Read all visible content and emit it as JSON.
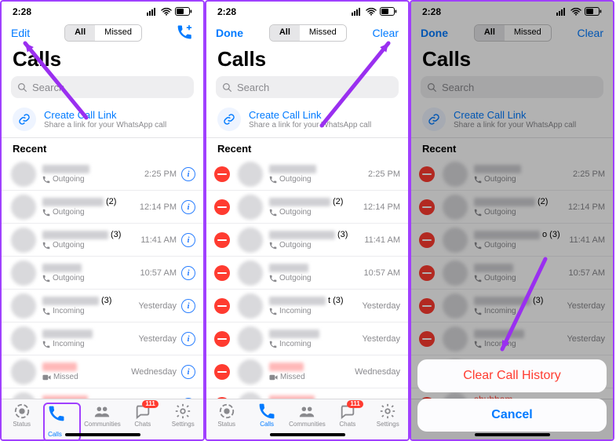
{
  "statusbar": {
    "time": "2:28"
  },
  "segments": {
    "all": "All",
    "missed": "Missed"
  },
  "title": "Calls",
  "search_placeholder": "Search",
  "create_link": {
    "title": "Create Call Link",
    "subtitle": "Share a link for your WhatsApp call"
  },
  "section_recent": "Recent",
  "screens": [
    {
      "left_btn": "Edit",
      "left_bold": false,
      "right_mode": "addcall"
    },
    {
      "left_btn": "Done",
      "left_bold": true,
      "right_mode": "clear",
      "right_label": "Clear"
    },
    {
      "left_btn": "Done",
      "left_bold": true,
      "right_mode": "clear",
      "right_label": "Clear"
    }
  ],
  "rows": [
    {
      "w": 60,
      "count": "",
      "type": "outgoing",
      "kind": "phone",
      "time": "2:25 PM"
    },
    {
      "w": 78,
      "count": "(2)",
      "type": "outgoing",
      "kind": "phone",
      "time": "12:14 PM"
    },
    {
      "w": 84,
      "count": "(3)",
      "type": "outgoing",
      "kind": "phone",
      "time": "11:41 AM"
    },
    {
      "w": 50,
      "count": "",
      "type": "outgoing",
      "kind": "phone",
      "time": "10:57 AM"
    },
    {
      "w": 72,
      "count": "(3)",
      "type": "incoming",
      "kind": "phone",
      "time": "Yesterday"
    },
    {
      "w": 64,
      "count": "",
      "type": "incoming",
      "kind": "phone",
      "time": "Yesterday"
    },
    {
      "w": 44,
      "count": "",
      "type": "missed",
      "kind": "video",
      "time": "Wednesday"
    },
    {
      "w": 58,
      "count": "",
      "type": "missed",
      "kind": "phone",
      "time": "Wednesday"
    }
  ],
  "rows_variant_b_index4_label": "t",
  "rows_variant_c_index4_label": "",
  "row8_name_c": "shubham",
  "type_labels": {
    "outgoing": "Outgoing",
    "incoming": "Incoming",
    "missed": "Missed"
  },
  "tabs": [
    {
      "id": "status",
      "label": "Status"
    },
    {
      "id": "calls",
      "label": "Calls"
    },
    {
      "id": "communities",
      "label": "Communities"
    },
    {
      "id": "chats",
      "label": "Chats",
      "badge": "111"
    },
    {
      "id": "settings",
      "label": "Settings"
    }
  ],
  "sheet": {
    "clear": "Clear Call History",
    "cancel": "Cancel"
  },
  "variant_c_index3_count": "o (3)"
}
